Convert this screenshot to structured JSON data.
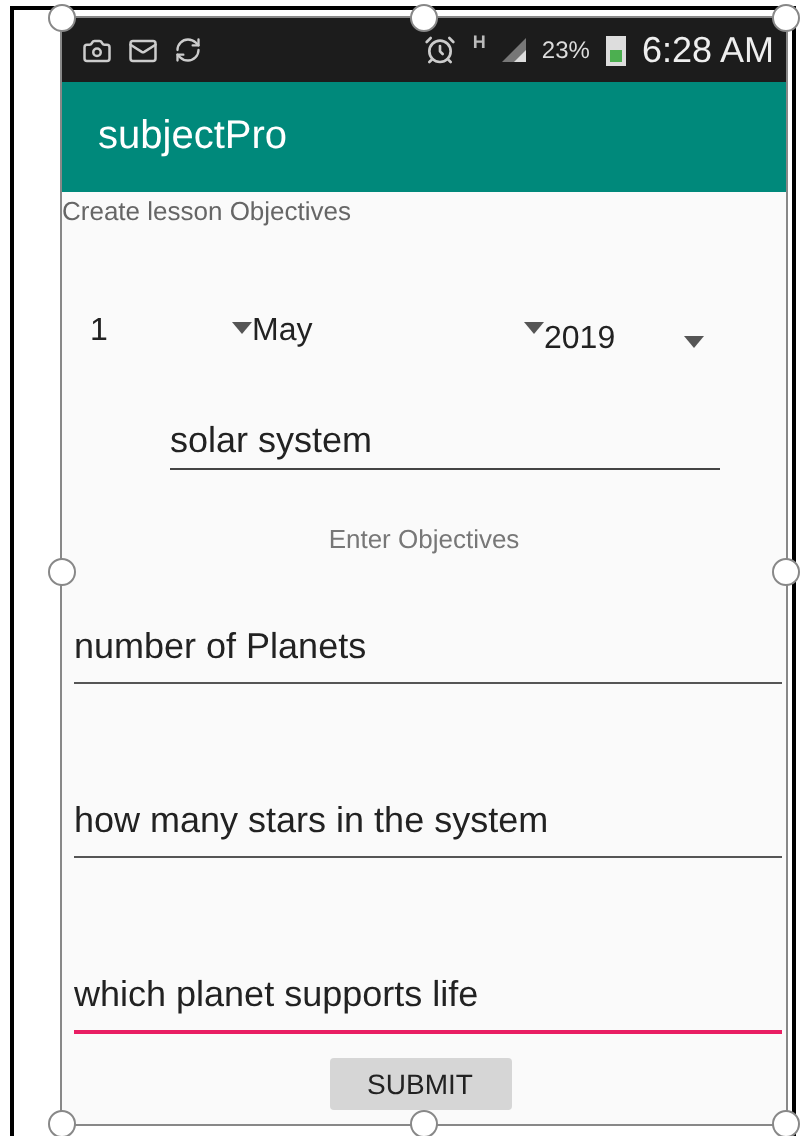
{
  "status_bar": {
    "network_type": "H",
    "battery": "23%",
    "time": "6:28 AM"
  },
  "app_bar": {
    "title": "subjectPro"
  },
  "heading": "Create lesson Objectives",
  "date_spinners": [
    {
      "value": "1"
    },
    {
      "value": "May"
    },
    {
      "value": "2019"
    }
  ],
  "topic_field": {
    "value": "solar system"
  },
  "objectives_label": "Enter Objectives",
  "objective_fields": [
    {
      "value": "number of Planets",
      "focused": false
    },
    {
      "value": "how many stars in the system",
      "focused": false
    },
    {
      "value": "which planet supports life",
      "focused": true
    }
  ],
  "submit_button": "SUBMIT"
}
